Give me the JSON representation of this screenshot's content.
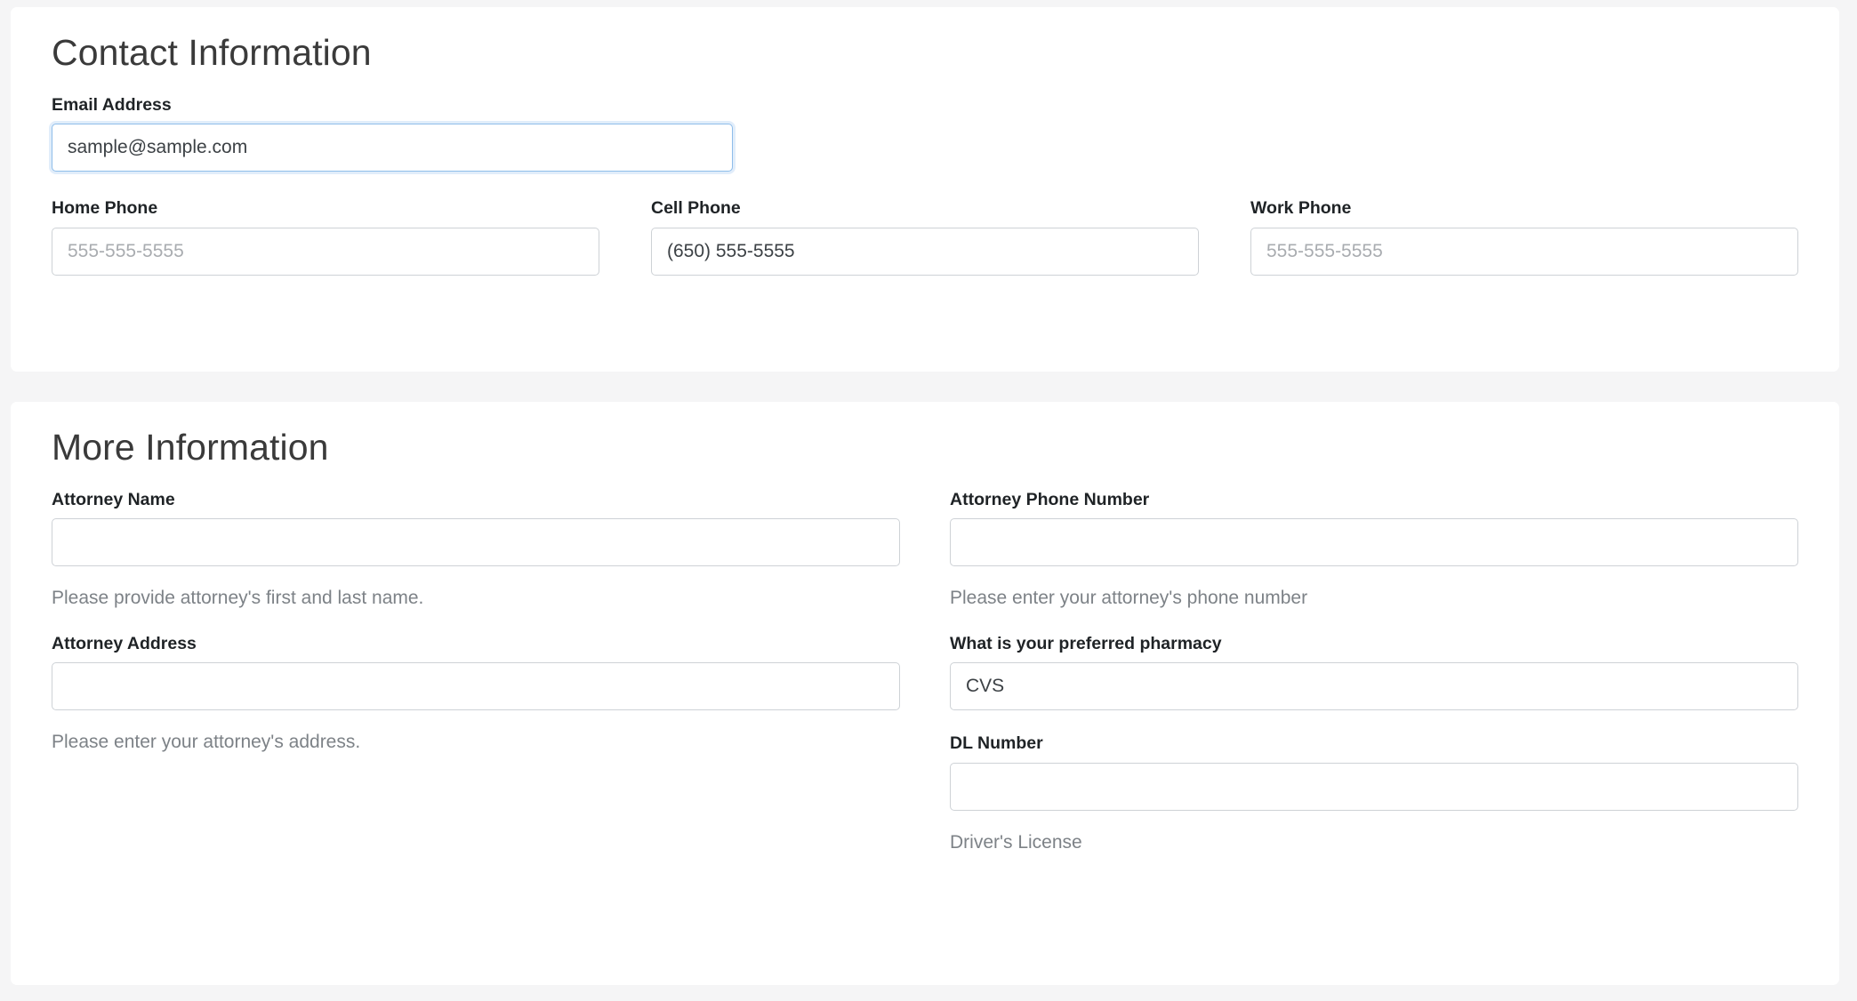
{
  "contact": {
    "title": "Contact Information",
    "email": {
      "label": "Email Address",
      "value": "sample@sample.com",
      "placeholder": "sample@sample.com"
    },
    "home_phone": {
      "label": "Home Phone",
      "value": "",
      "placeholder": "555-555-5555"
    },
    "cell_phone": {
      "label": "Cell Phone",
      "value": "(650) 555-5555",
      "placeholder": "555-555-5555"
    },
    "work_phone": {
      "label": "Work Phone",
      "value": "",
      "placeholder": "555-555-5555"
    }
  },
  "more": {
    "title": "More Information",
    "attorney_name": {
      "label": "Attorney Name",
      "value": "",
      "placeholder": "",
      "help": "Please provide attorney's first and last name."
    },
    "attorney_address": {
      "label": "Attorney Address",
      "value": "",
      "placeholder": "",
      "help": "Please enter your attorney's address."
    },
    "attorney_phone": {
      "label": "Attorney Phone Number",
      "value": "",
      "placeholder": "",
      "help": "Please enter your attorney's phone number"
    },
    "preferred_pharmacy": {
      "label": "What is your preferred pharmacy",
      "value": "CVS",
      "placeholder": ""
    },
    "dl_number": {
      "label": "DL Number",
      "value": "",
      "placeholder": "",
      "help": "Driver's License"
    }
  },
  "colors": {
    "page_background": "#f5f5f6",
    "card_background": "#ffffff",
    "label_text": "#1f2326",
    "heading_text": "#3a3a3a",
    "help_text": "#7d8287",
    "input_border": "#ced2d6",
    "input_focus_border": "#8ebdea",
    "placeholder_text": "#a9acb0",
    "value_text": "#3c4145"
  }
}
